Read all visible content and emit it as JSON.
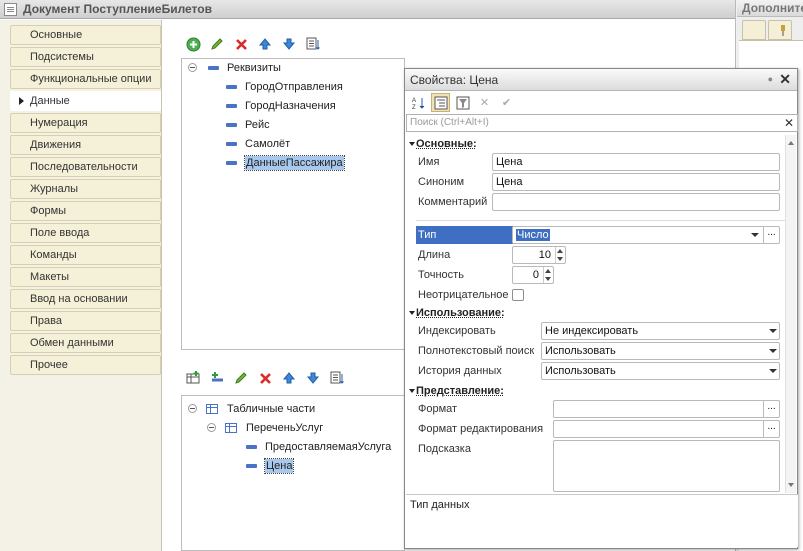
{
  "main": {
    "title": "Документ ПоступлениеБилетов",
    "nav": [
      {
        "label": "Основные",
        "active": false
      },
      {
        "label": "Подсистемы",
        "active": false
      },
      {
        "label": "Функциональные опции",
        "active": false
      },
      {
        "label": "Данные",
        "active": true
      },
      {
        "label": "Нумерация",
        "active": false
      },
      {
        "label": "Движения",
        "active": false
      },
      {
        "label": "Последовательности",
        "active": false
      },
      {
        "label": "Журналы",
        "active": false
      },
      {
        "label": "Формы",
        "active": false
      },
      {
        "label": "Поле ввода",
        "active": false
      },
      {
        "label": "Команды",
        "active": false
      },
      {
        "label": "Макеты",
        "active": false
      },
      {
        "label": "Ввод на основании",
        "active": false
      },
      {
        "label": "Права",
        "active": false
      },
      {
        "label": "Обмен данными",
        "active": false
      },
      {
        "label": "Прочее",
        "active": false
      }
    ],
    "attributes_tree": {
      "root": "Реквизиты",
      "items": [
        "ГородОтправления",
        "ГородНазначения",
        "Рейс",
        "Самолёт",
        "ДанныеПассажира"
      ],
      "selected": "ДанныеПассажира"
    },
    "tabular_tree": {
      "root": "Табличные части",
      "part": "ПереченьУслуг",
      "items": [
        "ПредоставляемаяУслуга",
        "Цена"
      ],
      "selected": "Цена"
    }
  },
  "extra": {
    "title": "Дополнительно"
  },
  "props": {
    "title": "Свойства: Цена",
    "search_placeholder": "Поиск (Ctrl+Alt+I)",
    "groups": {
      "basic": "Основные:",
      "usage": "Использование:",
      "presentation": "Представление:"
    },
    "labels": {
      "name": "Имя",
      "synonym": "Синоним",
      "comment": "Комментарий",
      "type": "Тип",
      "length": "Длина",
      "precision": "Точность",
      "non_negative": "Неотрицательное",
      "indexing": "Индексировать",
      "fulltext": "Полнотекстовый поиск",
      "history": "История данных",
      "format": "Формат",
      "edit_format": "Формат редактирования",
      "hint": "Подсказка"
    },
    "values": {
      "name": "Цена",
      "synonym": "Цена",
      "comment": "",
      "type": "Число",
      "length": "10",
      "precision": "0",
      "non_negative": false,
      "indexing": "Не индексировать",
      "fulltext": "Использовать",
      "history": "Использовать",
      "format": "",
      "edit_format": "",
      "hint": ""
    },
    "description": "Тип данных"
  }
}
